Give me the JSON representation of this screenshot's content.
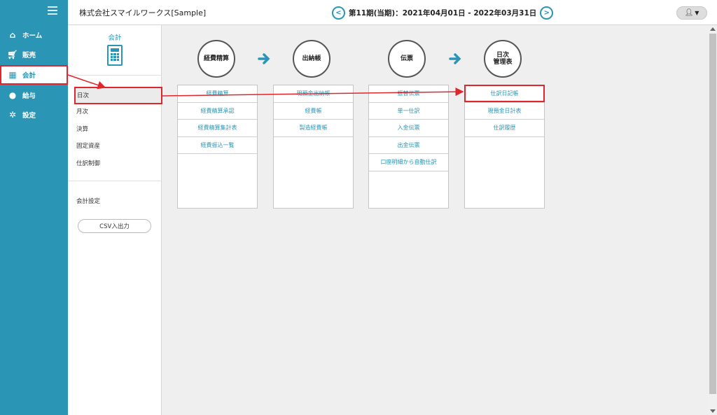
{
  "header": {
    "company": "株式会社スマイルワークス[Sample]",
    "period": "第11期(当期)：2021年04月01日 - 2022年03月31日",
    "prev_icon": "chevron-left-icon",
    "next_icon": "chevron-right-icon",
    "user_icon": "user-icon"
  },
  "nav": {
    "items": [
      {
        "label": "ホーム",
        "icon": "home-icon"
      },
      {
        "label": "販売",
        "icon": "cart-icon"
      },
      {
        "label": "会計",
        "icon": "calculator-icon",
        "active": true
      },
      {
        "label": "給与",
        "icon": "money-bag-icon"
      },
      {
        "label": "設定",
        "icon": "gear-icon"
      }
    ]
  },
  "subnav": {
    "title": "会計",
    "items": [
      "日次",
      "月次",
      "決算",
      "固定資産",
      "仕訳制御"
    ],
    "settings": "会計設定",
    "csv_button": "CSV入出力"
  },
  "flow": {
    "columns": [
      {
        "title": "経費精算",
        "links": [
          "経費精算",
          "経費精算承認",
          "経費精算集計表",
          "経費振込一覧"
        ]
      },
      {
        "title": "出納帳",
        "links": [
          "現預金出納帳",
          "経費帳",
          "製造経費帳"
        ]
      },
      {
        "title": "伝票",
        "links": [
          "振替伝票",
          "単一仕訳",
          "入金伝票",
          "出金伝票",
          "口座明細から自動仕訳"
        ]
      },
      {
        "title_line1": "日次",
        "title_line2": "管理表",
        "links": [
          "仕訳日記帳",
          "現預金日計表",
          "仕訳履歴"
        ]
      }
    ]
  },
  "colors": {
    "accent": "#2a95b5",
    "annotation": "#e0262c"
  }
}
